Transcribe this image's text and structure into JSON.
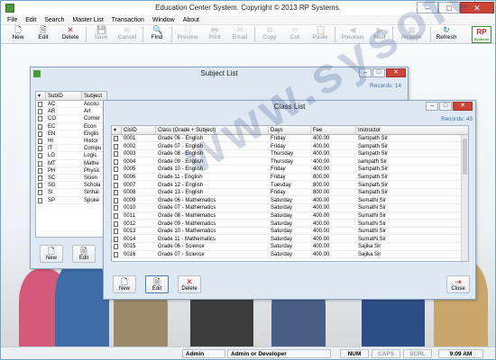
{
  "app": {
    "title": "Education Center System. Copyright © 2013 RP Systems.",
    "window_controls": {
      "minimize": "–",
      "maximize": "□",
      "close": "✕"
    }
  },
  "menu": {
    "items": [
      "File",
      "Edit",
      "Search",
      "Master List",
      "Transaction",
      "Window",
      "About"
    ]
  },
  "toolbar": {
    "buttons": [
      {
        "label": "New",
        "icon": "new-doc-icon",
        "enabled": true
      },
      {
        "label": "Edit",
        "icon": "edit-doc-icon",
        "enabled": true
      },
      {
        "label": "Delete",
        "icon": "delete-x-icon",
        "enabled": true
      },
      {
        "label": "Save",
        "icon": "save-icon",
        "enabled": false
      },
      {
        "label": "Cancel",
        "icon": "cancel-icon",
        "enabled": false
      },
      {
        "label": "Find",
        "icon": "find-icon",
        "enabled": true
      },
      {
        "label": "Preview",
        "icon": "preview-icon",
        "enabled": false
      },
      {
        "label": "Print",
        "icon": "print-icon",
        "enabled": false
      },
      {
        "label": "Email",
        "icon": "email-icon",
        "enabled": false
      },
      {
        "label": "Copy",
        "icon": "copy-icon",
        "enabled": false
      },
      {
        "label": "Cut",
        "icon": "cut-icon",
        "enabled": false
      },
      {
        "label": "Paste",
        "icon": "paste-icon",
        "enabled": false
      },
      {
        "label": "Previous",
        "icon": "previous-icon",
        "enabled": false
      },
      {
        "label": "Next",
        "icon": "next-icon",
        "enabled": false
      },
      {
        "label": "Arrange",
        "icon": "arrange-icon",
        "enabled": false
      },
      {
        "label": "Refresh",
        "icon": "refresh-icon",
        "enabled": true
      }
    ],
    "logo": {
      "text": "RP",
      "subtext": "Systems"
    }
  },
  "subject_list": {
    "title": "Subject List",
    "records": "Records: 14",
    "columns": [
      "SubID",
      "Subject"
    ],
    "rows": [
      [
        "AC",
        "Accou"
      ],
      [
        "AR",
        "Art"
      ],
      [
        "CO",
        "Comer"
      ],
      [
        "EC",
        "Econ"
      ],
      [
        "EN",
        "Englis"
      ],
      [
        "HI",
        "Histor"
      ],
      [
        "IT",
        "Compu"
      ],
      [
        "LG",
        "Logic"
      ],
      [
        "MT",
        "Mathe"
      ],
      [
        "PH",
        "Physic"
      ],
      [
        "SC",
        "Scien"
      ],
      [
        "SG",
        "Schola"
      ],
      [
        "SI",
        "Sinhal"
      ],
      [
        "SP",
        "Spoke"
      ]
    ],
    "buttons": [
      "New",
      "Edit"
    ]
  },
  "class_list": {
    "title": "Class List",
    "records": "Records: 43",
    "columns": [
      "ClsID",
      "Class (Grade + Subject)",
      "Days",
      "Fee",
      "Instructor"
    ],
    "rows": [
      [
        "0001",
        "Grade 06 - English",
        "Friday",
        "400.00",
        "Sampath Sir"
      ],
      [
        "0002",
        "Grade 07 - English",
        "Friday",
        "400.00",
        "Sampath Sir"
      ],
      [
        "0003",
        "Grade 08 - English",
        "Thursday",
        "400.00",
        "Sampath Sir"
      ],
      [
        "0004",
        "Grade 09 - English",
        "Thursday",
        "400.00",
        "sampath Sir"
      ],
      [
        "0005",
        "Grade 10 - English",
        "Friday",
        "400.00",
        "Sampath Sir"
      ],
      [
        "0006",
        "Grade 11 - English",
        "Friday",
        "800.00",
        "Sampath Sir"
      ],
      [
        "0007",
        "Grade 12 - English",
        "Tuesday",
        "800.00",
        "Sampath Sir"
      ],
      [
        "0008",
        "Grade 13 - English",
        "Friday",
        "800.00",
        "Sampath Sir"
      ],
      [
        "0009",
        "Grade 06 - Mathematics",
        "Saturday",
        "400.00",
        "Sumathi Sir"
      ],
      [
        "0010",
        "Grade 07 - Mathematics",
        "Saturday",
        "400.00",
        "Sumathi Sir"
      ],
      [
        "0011",
        "Grade 08 - Mathematics",
        "Saturday",
        "400.00",
        "Sumathi Sir"
      ],
      [
        "0012",
        "Grade 09 - Mathematics",
        "Saturday",
        "400.00",
        "Sumathi Sir"
      ],
      [
        "0013",
        "Grade 10 - Mathematics",
        "Saturday",
        "400.00",
        "Sumathi Sir"
      ],
      [
        "0014",
        "Grade 11 - Mathematics",
        "Saturday",
        "400.00",
        "Sumathi Sir"
      ],
      [
        "0015",
        "Grade 06 - Science",
        "Saturday",
        "400.00",
        "Sajika Sir"
      ],
      [
        "0016",
        "Grade 07 - Science",
        "Saturday",
        "400.00",
        "Sajika Sir"
      ]
    ],
    "buttons": [
      "New",
      "Edit",
      "Delete",
      "Close"
    ]
  },
  "watermark": "www.sysoft.lk",
  "status": {
    "user": "Admin",
    "role": "Admin or Developer",
    "num": "NUM",
    "caps": "CAPS",
    "scrl": "SCRL",
    "time": "9:09 AM"
  }
}
